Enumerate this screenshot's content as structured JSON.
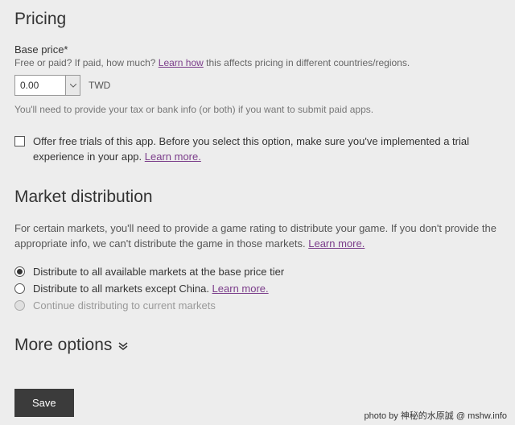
{
  "pricing": {
    "heading": "Pricing",
    "base_price_label": "Base price*",
    "help_prefix": "Free or paid? If paid, how much? ",
    "help_link": "Learn how",
    "help_suffix": " this affects pricing in different countries/regions.",
    "price_value": "0.00",
    "currency": "TWD",
    "tax_note": "You'll need to provide your tax or bank info (or both) if you want to submit paid apps.",
    "trial_text": "Offer free trials of this app. Before you select this option, make sure you've implemented a trial experience in your app. ",
    "trial_link": "Learn more."
  },
  "market": {
    "heading": "Market distribution",
    "help_text": "For certain markets, you'll need to provide a game rating to distribute your game. If you don't provide the appropriate info, we can't distribute the game in those markets. ",
    "help_link": "Learn more.",
    "opt1": "Distribute to all available markets at the base price tier",
    "opt2_text": "Distribute to all markets except China. ",
    "opt2_link": "Learn more.",
    "opt3": "Continue distributing to current markets"
  },
  "more_options": "More options",
  "save_label": "Save",
  "watermark": "photo by 神秘的水原誠 @ mshw.info"
}
